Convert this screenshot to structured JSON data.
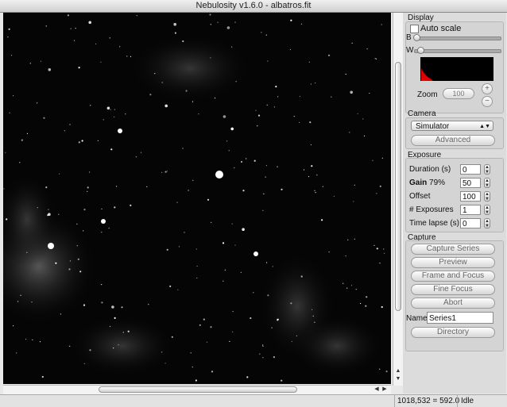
{
  "window": {
    "title": "Nebulosity v1.6.0 - albatros.fit"
  },
  "display": {
    "header": "Display",
    "autoscale_label": "Auto scale",
    "autoscale_checked": false,
    "b_label": "B",
    "w_label": "W",
    "zoom_label": "Zoom",
    "zoom_value": "100",
    "zoom_in": "+",
    "zoom_out": "−",
    "histogram_color": "#e00000"
  },
  "camera": {
    "header": "Camera",
    "selected": "Simulator",
    "advanced_label": "Advanced"
  },
  "exposure": {
    "header": "Exposure",
    "duration_label": "Duration (s)",
    "duration_value": "0",
    "gain_label": "Gain",
    "gain_percent": "79%",
    "gain_value": "50",
    "offset_label": "Offset",
    "offset_value": "100",
    "num_exposures_label": "# Exposures",
    "num_exposures_value": "1",
    "timelapse_label": "Time lapse (s)",
    "timelapse_value": "0"
  },
  "capture": {
    "header": "Capture",
    "capture_series_label": "Capture Series",
    "preview_label": "Preview",
    "frame_focus_label": "Frame and Focus",
    "fine_focus_label": "Fine Focus",
    "abort_label": "Abort",
    "name_label": "Name",
    "name_value": "Series1",
    "directory_label": "Directory"
  },
  "status": {
    "coords": "1018,532 = 592.0",
    "state": "Idle"
  }
}
